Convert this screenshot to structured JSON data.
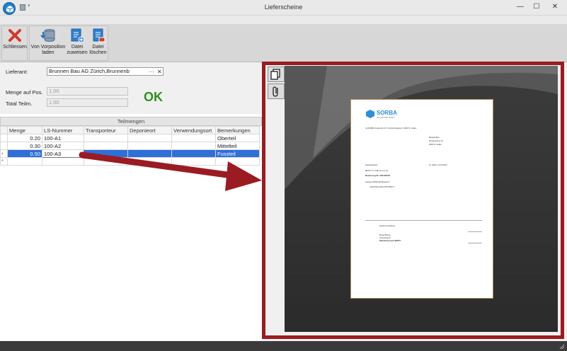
{
  "window": {
    "title": "Lieferscheine",
    "minimize": "—",
    "maximize": "☐",
    "close": "✕"
  },
  "ribbon": {
    "buttons": [
      {
        "label_line1": "Schliessen",
        "label_line2": ""
      },
      {
        "label_line1": "Von Vorposition",
        "label_line2": "laden"
      },
      {
        "label_line1": "Datei",
        "label_line2": "zuweisen"
      },
      {
        "label_line1": "Datei",
        "label_line2": "löschen"
      }
    ]
  },
  "form": {
    "lieferant_label": "Lieferant:",
    "lieferant_value": "Brunnen Bau AG Zürich,Brunnenb",
    "menge_label": "Menge auf Pos.",
    "menge_value": "1.00",
    "total_label": "Total Teilm.",
    "total_value": "1.00",
    "status": "OK",
    "more_glyph": "···",
    "clear_glyph": "✕"
  },
  "grid": {
    "title": "Teilmengen",
    "columns": [
      "Menge",
      "LS-Nummer",
      "Transporteur",
      "Deponieort",
      "Verwendungsort",
      "Bemerkungen"
    ],
    "rows": [
      {
        "menge": "0.20",
        "ls": "100-A1",
        "transporteur": "",
        "deponieort": "",
        "verwendungsort": "",
        "bemerkungen": "Oberteil"
      },
      {
        "menge": "0.30",
        "ls": "100-A2",
        "transporteur": "",
        "deponieort": "",
        "verwendungsort": "",
        "bemerkungen": "Mittelteil"
      },
      {
        "menge": "0.50",
        "ls": "100-A3",
        "transporteur": "",
        "deponieort": "",
        "verwendungsort": "",
        "bemerkungen": "Fussteil"
      }
    ],
    "selected_indicator": "›",
    "new_row_indicator": "*"
  },
  "document_preview": {
    "brand": "SORBA",
    "tagline": "AUF ZUKUNFT BAUEN",
    "sender_line": "mySORBA Testkunde LS 5, Schochengasse 6, 9000 St. Gallen",
    "recipient": [
      "Beispiel Bau",
      "Musterstrasse 22",
      "9000 St. Gallen"
    ],
    "place_date": "St. Gallen, 21.06.2021",
    "contact": "Sachbearbeiter",
    "vat": "MWST. Nr. CHE-xxx.xxx.xxx",
    "invoice_title": "Rechnung Nr. 202100001",
    "order": "Auftrag 210026  QR-Beispiel 1",
    "iban": "CH18 0024 0240 3790 8600 0",
    "summary_title": "Zusammenstellung",
    "lines": [
      "Brutto-Betrag",
      "Umsatzsteuer",
      "Nettobetrag nach MWST"
    ]
  },
  "colors": {
    "accent_frame": "#9b1b22",
    "ok_green": "#2f8f1f",
    "selection": "#2e6fd8"
  }
}
